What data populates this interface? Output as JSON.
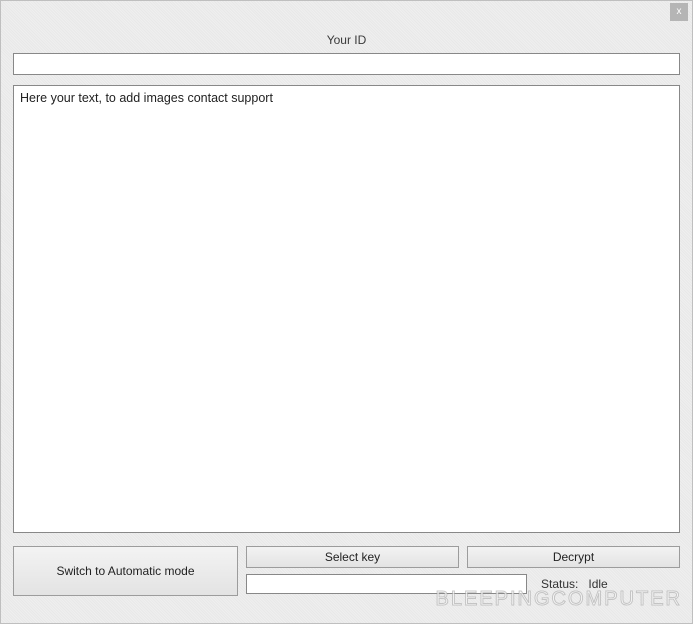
{
  "titlebar": {
    "close_label": "x"
  },
  "main": {
    "id_label": "Your ID",
    "id_value": "",
    "text_value": "Here your text, to add images contact support"
  },
  "buttons": {
    "switch_mode": "Switch to Automatic mode",
    "select_key": "Select key",
    "decrypt": "Decrypt"
  },
  "status": {
    "path_value": "",
    "label": "Status:",
    "value": "Idle"
  },
  "watermark": "BLEEPINGCOMPUTER"
}
